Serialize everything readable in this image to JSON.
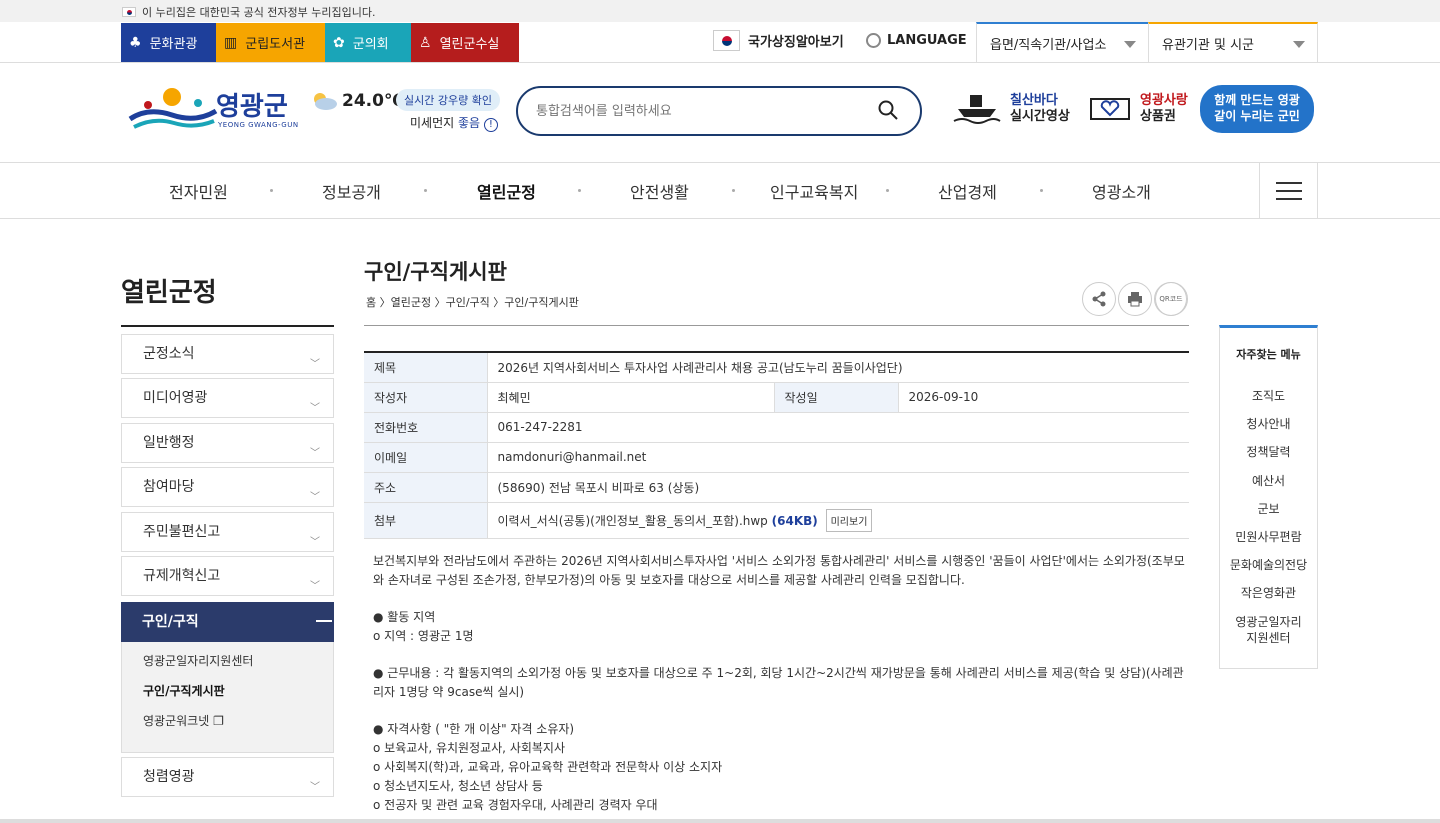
{
  "gov_banner": {
    "text": "이 누리집은 대한민국 공식 전자정부 누리집입니다."
  },
  "quick_links": [
    {
      "label": "문화관광",
      "icon": "person-culture-icon"
    },
    {
      "label": "군립도서관",
      "icon": "book-icon"
    },
    {
      "label": "군의회",
      "icon": "flower-emblem-icon"
    },
    {
      "label": "열린군수실",
      "icon": "person-icon"
    }
  ],
  "util": {
    "national_symbol": "국가상징알아보기",
    "language": "LANGUAGE",
    "select1": "읍면/직속기관/사업소",
    "select2": "유관기관 및 시군"
  },
  "header": {
    "logo_title": "영광군",
    "logo_sub": "YEONG GWANG-GUN",
    "temperature": "24.0℃",
    "rain_button": "실시간 강우량 확인",
    "dust_label": "미세먼지",
    "dust_value": "좋음",
    "search_placeholder": "통합검색어를 입력하세요",
    "chilsan_line1": "칠산바다",
    "chilsan_line2": "실시간영상",
    "gift_line1": "영광사랑",
    "gift_line2": "상품권",
    "slogan_line1": "함께 만드는 영광",
    "slogan_line2": "같이 누리는 군민"
  },
  "gnb": [
    "전자민원",
    "정보공개",
    "열린군정",
    "안전생활",
    "인구교육복지",
    "산업경제",
    "영광소개"
  ],
  "gnb_active": "열린군정",
  "lnb": {
    "title": "열린군정",
    "items": [
      "군정소식",
      "미디어영광",
      "일반행정",
      "참여마당",
      "주민불편신고",
      "규제개혁신고"
    ],
    "active": "구인/구직",
    "sub_items": [
      "영광군일자리지원센터",
      "구인/구직게시판",
      "영광군워크넷"
    ],
    "last_item": "청렴영광"
  },
  "page": {
    "title": "구인/구직게시판",
    "breadcrumb": "홈 〉열린군정 〉구인/구직 〉구인/구직게시판",
    "tool_qr": "QR코드"
  },
  "post": {
    "label_subject": "제목",
    "subject": "2026년 지역사회서비스 투자사업 사례관리사 채용 공고(남도누리 꿈들이사업단)",
    "label_author": "작성자",
    "author": "최혜민",
    "label_date": "작성일",
    "date": "2026-09-10",
    "label_phone": "전화번호",
    "phone": "061-247-2281",
    "label_email": "이메일",
    "email": "namdonuri@hanmail.net",
    "label_address": "주소",
    "address": "(58690) 전남 목포시 비파로 63 (상동)",
    "label_attach": "첨부",
    "attach_name": "이력서_서식(공통)(개인정보_활용_동의서_포함).hwp",
    "attach_size": "(64KB)",
    "preview": "미리보기"
  },
  "body": {
    "intro": "보건복지부와 전라남도에서 주관하는 2026년 지역사회서비스투자사업 '서비스 소외가정 통합사례관리' 서비스를 시행중인 '꿈들이 사업단'에서는 소외가정(조부모와 손자녀로 구성된 조손가정, 한부모가정)의 아동 및 보호자를 대상으로 서비스를 제공할 사례관리 인력을 모집합니다.",
    "area_title": "● 활동 지역",
    "area_detail": "o 지역 : 영광군 1명",
    "work": "● 근무내용 : 각 활동지역의 소외가정 아동 및 보호자를 대상으로 주 1~2회, 회당 1시간~2시간씩 재가방문을 통해 사례관리 서비스를 제공(학습 및 상담)(사례관리자 1명당 약 9case씩 실시)",
    "qual_title": "● 자격사항 ( \"한 개 이상\" 자격 소유자)",
    "qual1": "o 보육교사, 유치원정교사, 사회복지사",
    "qual2": "o 사회복지(학)과, 교육과, 유아교육학 관련학과 전문학사 이상 소지자",
    "qual3": "o 청소년지도사, 청소년 상담사 등",
    "qual4": "o 전공자 및 관련 교육 경험자우대, 사례관리 경력자 우대"
  },
  "quick_menu": {
    "title": "자주찾는 메뉴",
    "items": [
      "조직도",
      "청사안내",
      "정책달력",
      "예산서",
      "군보",
      "민원사무편람",
      "문화예술의전당",
      "작은영화관",
      "영광군일자리 지원센터"
    ]
  },
  "colors": {
    "navy": "#1e3f9b",
    "lnb_active": "#2b3b6b",
    "accent_blue": "#2f7fd1",
    "table_head": "#eef3fa"
  }
}
